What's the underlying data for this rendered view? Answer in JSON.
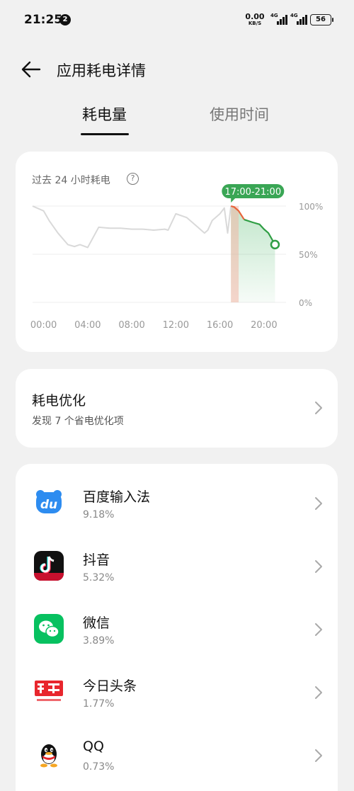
{
  "status_bar": {
    "time": "21:25",
    "notification_count": "2",
    "net_speed_value": "0.00",
    "net_speed_unit": "KB/S",
    "network_1": "4G",
    "network_2": "4G",
    "battery": "56"
  },
  "header": {
    "title": "应用耗电详情"
  },
  "tabs": [
    {
      "label": "耗电量",
      "active": true
    },
    {
      "label": "使用时间",
      "active": false
    }
  ],
  "chart": {
    "title": "过去 24 小时耗电",
    "range_badge": "17:00-21:00"
  },
  "chart_data": {
    "type": "line",
    "title": "过去 24 小时耗电",
    "x_ticks": [
      "00:00",
      "04:00",
      "08:00",
      "12:00",
      "16:00",
      "20:00"
    ],
    "y_ticks": [
      "100%",
      "50%",
      "0%"
    ],
    "ylim": [
      0,
      100
    ],
    "xlim": [
      -1,
      22
    ],
    "grid": true,
    "highlight_range": "17:00-21:00",
    "series": [
      {
        "x": [
          -1,
          0,
          0.5,
          1.3,
          2.2,
          2.8,
          3.3,
          4.0,
          5.0,
          6.0,
          7.0,
          8.0,
          9.0,
          10.0,
          11.0,
          11.3,
          12.0,
          13.0,
          14.0,
          14.6,
          14.9,
          15.3,
          16.0,
          16.4,
          16.7,
          17.0
        ],
        "values": [
          100,
          95,
          85,
          72,
          60,
          58,
          60,
          57,
          78,
          77,
          77,
          76,
          76,
          75,
          76,
          75,
          92,
          88,
          78,
          72,
          75,
          85,
          92,
          98,
          72,
          100
        ]
      },
      {
        "x": [
          17.0,
          17.3,
          17.7,
          18.2,
          19.0,
          19.6,
          20.0,
          20.4,
          21.0
        ],
        "values": [
          100,
          99,
          95,
          86,
          83,
          81,
          76,
          72,
          60
        ]
      }
    ]
  },
  "optimization": {
    "title": "耗电优化",
    "subtitle": "发现 7 个省电优化项"
  },
  "apps": [
    {
      "name": "百度输入法",
      "percent": "9.18%",
      "icon": "baidu-input-icon"
    },
    {
      "name": "抖音",
      "percent": "5.32%",
      "icon": "douyin-icon"
    },
    {
      "name": "微信",
      "percent": "3.89%",
      "icon": "wechat-icon"
    },
    {
      "name": "今日头条",
      "percent": "1.77%",
      "icon": "toutiao-icon"
    },
    {
      "name": "QQ",
      "percent": "0.73%",
      "icon": "qq-icon"
    }
  ],
  "colors": {
    "accent_green": "#2f9e44",
    "orange_segment": "#e8633a",
    "card_bg": "#ffffff",
    "page_bg": "#f1f1f1"
  }
}
